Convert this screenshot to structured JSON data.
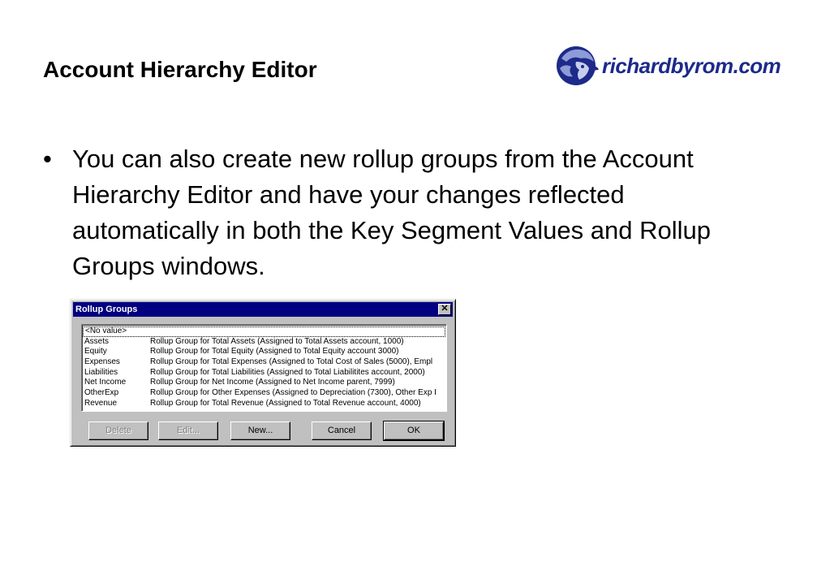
{
  "slide": {
    "title": "Account Hierarchy Editor",
    "logo_text": "richardbyrom.com",
    "bullet_marker": "•",
    "bullet_text": "You can also create new rollup groups from the Account Hierarchy Editor and have your changes reflected automatically in both the Key Segment Values and Rollup Groups windows."
  },
  "dialog": {
    "title": "Rollup Groups",
    "close_glyph": "✕",
    "list": [
      {
        "name": "<No value>",
        "desc": ""
      },
      {
        "name": "Assets",
        "desc": "Rollup Group for Total Assets (Assigned to Total Assets account, 1000)"
      },
      {
        "name": "Equity",
        "desc": "Rollup Group for Total Equity (Assigned to Total Equity account 3000)"
      },
      {
        "name": "Expenses",
        "desc": "Rollup Group for Total Expenses (Assigned to Total Cost of Sales (5000), Empl"
      },
      {
        "name": "Liabilities",
        "desc": "Rollup Group for Total Liabilities (Assigned to Total Liabilitites account, 2000)"
      },
      {
        "name": "Net Income",
        "desc": "Rollup Group for Net Income (Assigned to Net Income parent, 7999)"
      },
      {
        "name": "OtherExp",
        "desc": "Rollup Group for Other Expenses (Assigned to Depreciation (7300), Other Exp I"
      },
      {
        "name": "Revenue",
        "desc": "Rollup Group for Total Revenue (Assigned to Total Revenue account, 4000)"
      }
    ],
    "buttons": {
      "delete": "Delete",
      "edit": "Edit...",
      "new": "New...",
      "cancel": "Cancel",
      "ok": "OK"
    }
  },
  "colors": {
    "titlebar": "#000080",
    "logo": "#1d2a8a",
    "dialog_face": "#c0c0c0"
  }
}
